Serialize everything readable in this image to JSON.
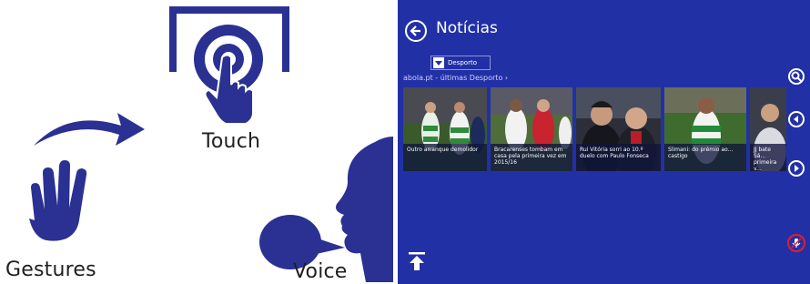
{
  "illustration": {
    "touch_label": "Touch",
    "gestures_label": "Gestures",
    "voice_label": "Voice",
    "icon_color": "#2a3192"
  },
  "app": {
    "title": "Notícias",
    "category": "Desporto",
    "source_line": "abola.pt - últimas Desporto ›",
    "background": "#2230a6",
    "tiles": [
      {
        "caption": "Outro arranque demolidor"
      },
      {
        "caption": "Bracarenses tombam em casa pela primeira vez em 2015/16"
      },
      {
        "caption": "Rui Vitória sorri ao 10.º duelo com Paulo Fonseca"
      },
      {
        "caption": "Slimani: do prémio ao... castigo"
      },
      {
        "caption": "JJ bate Sá... primeira v..."
      }
    ]
  }
}
